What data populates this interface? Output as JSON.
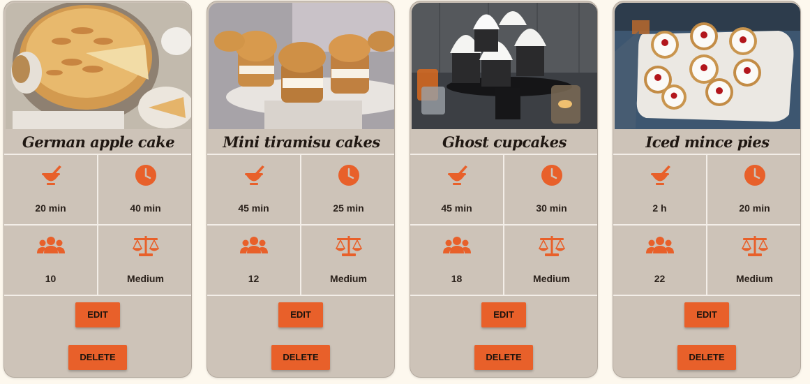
{
  "accent_color": "#e8602a",
  "card_background": "#cdc3b8",
  "recipes": [
    {
      "title": "German apple cake",
      "prep_time": "20 min",
      "cook_time": "40 min",
      "servings": "10",
      "difficulty": "Medium",
      "edit_label": "EDIT",
      "delete_label": "DELETE"
    },
    {
      "title": "Mini tiramisu cakes",
      "prep_time": "45 min",
      "cook_time": "25 min",
      "servings": "12",
      "difficulty": "Medium",
      "edit_label": "EDIT",
      "delete_label": "DELETE"
    },
    {
      "title": "Ghost cupcakes",
      "prep_time": "45 min",
      "cook_time": "30 min",
      "servings": "18",
      "difficulty": "Medium",
      "edit_label": "EDIT",
      "delete_label": "DELETE"
    },
    {
      "title": "Iced mince pies",
      "prep_time": "2 h",
      "cook_time": "20 min",
      "servings": "22",
      "difficulty": "Medium",
      "edit_label": "EDIT",
      "delete_label": "DELETE"
    }
  ],
  "icons": {
    "prep": "mortar-pestle-icon",
    "cook": "clock-icon",
    "servings": "users-icon",
    "difficulty": "balance-scale-icon"
  }
}
